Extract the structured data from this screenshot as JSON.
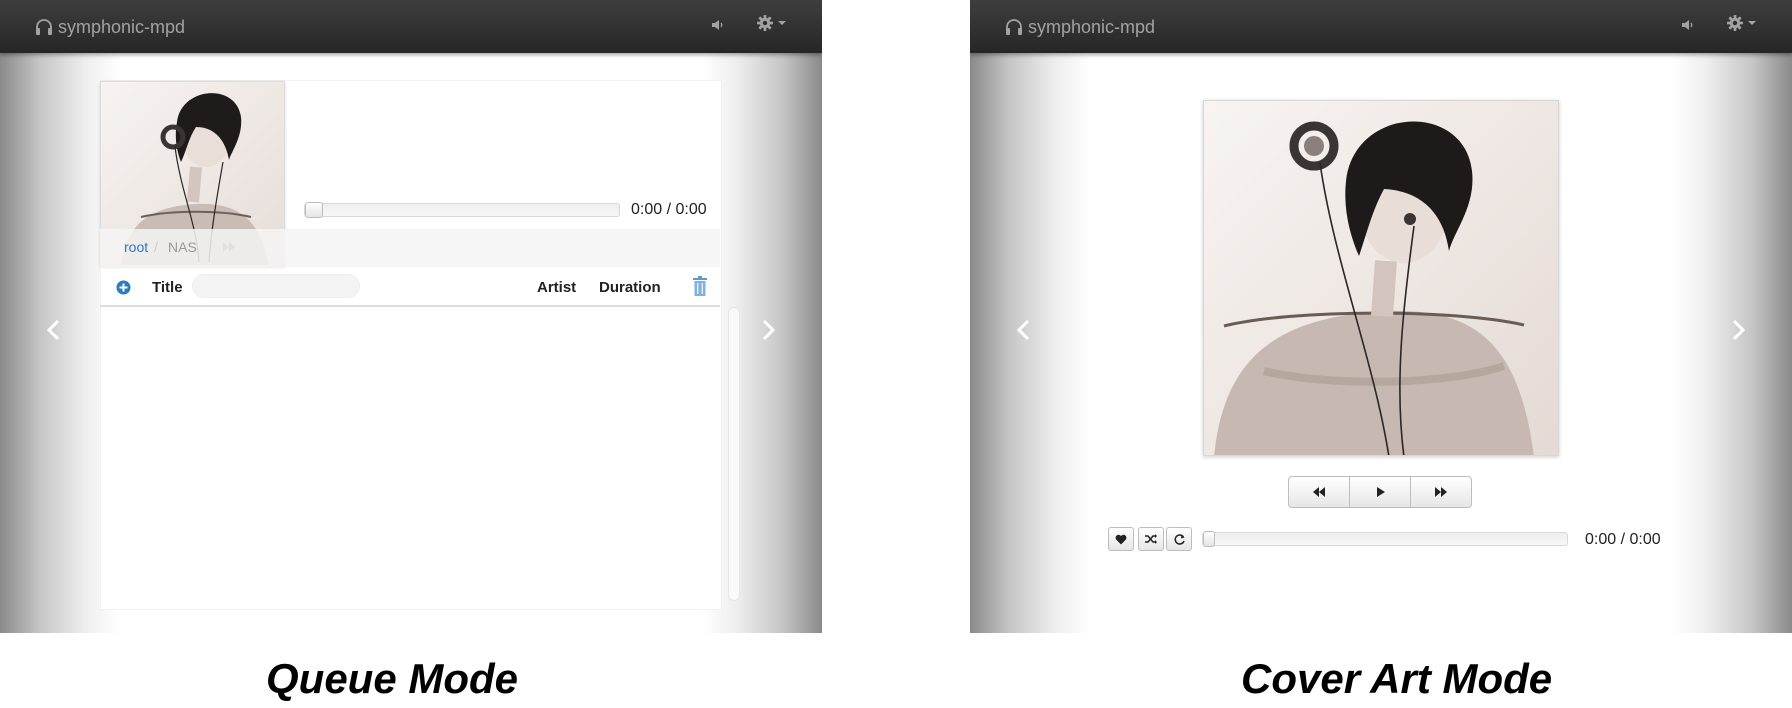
{
  "brand": {
    "name": "symphonic-mpd"
  },
  "icons": {
    "brand": "headphones-icon",
    "volume": "volume-icon",
    "settings": "gear-icon",
    "prev_panel": "chevron-left-icon",
    "next_panel": "chevron-right-icon",
    "add": "plus-circle-icon",
    "clear": "trash-icon",
    "rewind": "backward-icon",
    "play": "play-icon",
    "forward": "forward-icon",
    "favorite": "heart-icon",
    "shuffle": "shuffle-icon",
    "repeat": "repeat-icon"
  },
  "colors": {
    "navbar_top": "#3e3e3e",
    "navbar_bottom": "#262626",
    "link": "#2a7bc0",
    "text": "#222222"
  },
  "queue_mode": {
    "time": "0:00 / 0:00",
    "progress": 0,
    "breadcrumb": {
      "root": "root",
      "separator": "/",
      "current": "NAS"
    },
    "columns": {
      "title": "Title",
      "artist": "Artist",
      "duration": "Duration"
    },
    "filter_placeholder": "",
    "caption": "Queue Mode"
  },
  "cover_mode": {
    "time": "0:00 / 0:00",
    "progress": 0,
    "caption": "Cover Art Mode"
  }
}
